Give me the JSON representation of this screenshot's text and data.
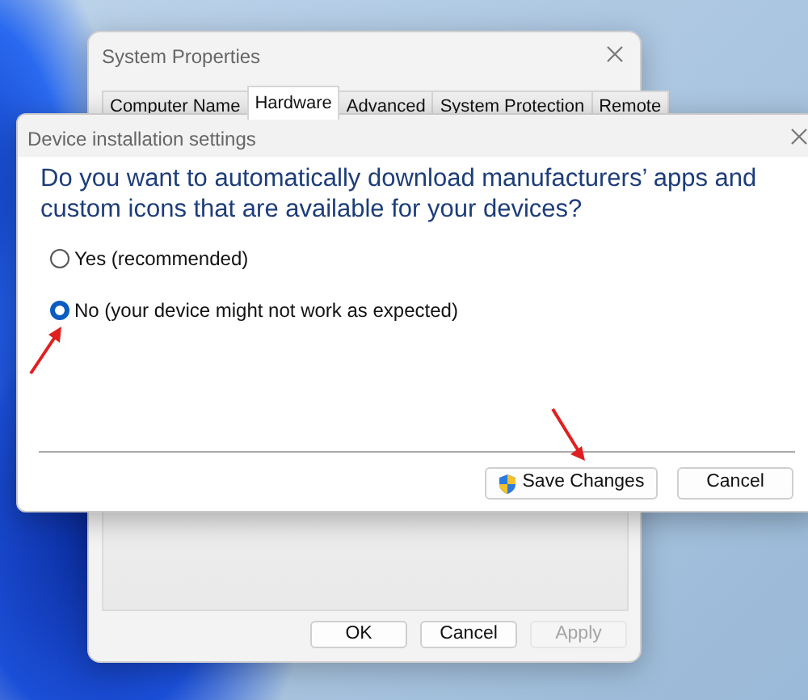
{
  "system_properties": {
    "title": "System Properties",
    "tabs": [
      {
        "label": "Computer Name",
        "selected": false
      },
      {
        "label": "Hardware",
        "selected": true
      },
      {
        "label": "Advanced",
        "selected": false
      },
      {
        "label": "System Protection",
        "selected": false
      },
      {
        "label": "Remote",
        "selected": false
      }
    ],
    "buttons": [
      {
        "label": "OK",
        "disabled": false
      },
      {
        "label": "Cancel",
        "disabled": false
      },
      {
        "label": "Apply",
        "disabled": true
      }
    ]
  },
  "device_installation_dialog": {
    "title": "Device installation settings",
    "question": "Do you want to automatically download manufacturers’ apps and custom icons that are available for your devices?",
    "options": [
      {
        "label": "Yes (recommended)",
        "selected": false
      },
      {
        "label": "No (your device might not work as expected)",
        "selected": true
      }
    ],
    "buttons": [
      {
        "label": "Save Changes",
        "kind": "shield"
      },
      {
        "label": "Cancel",
        "kind": "plain"
      }
    ]
  }
}
